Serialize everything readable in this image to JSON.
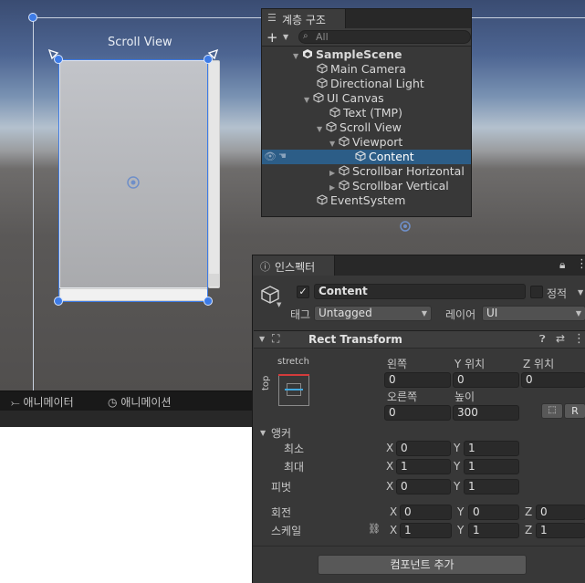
{
  "scene": {
    "canvas_label": "Scroll View"
  },
  "bottom_tabs": [
    {
      "label": "애니메이터",
      "icon": "animator-icon"
    },
    {
      "label": "애니메이션",
      "icon": "animation-icon"
    }
  ],
  "hierarchy": {
    "tab_label": "계층 구조",
    "tab_icon": "list-icon",
    "search_placeholder": "All",
    "add_icon": "plus-icon",
    "items": [
      {
        "label": "SampleScene",
        "depth": 0,
        "expanded": true,
        "icon": "unity-scene-icon",
        "bold": true
      },
      {
        "label": "Main Camera",
        "depth": 1,
        "icon": "cube-icon"
      },
      {
        "label": "Directional Light",
        "depth": 1,
        "icon": "cube-icon"
      },
      {
        "label": "UI Canvas",
        "depth": 1,
        "expanded": true,
        "icon": "cube-icon"
      },
      {
        "label": "Text (TMP)",
        "depth": 2,
        "icon": "cube-icon"
      },
      {
        "label": "Scroll View",
        "depth": 2,
        "expanded": true,
        "icon": "cube-icon"
      },
      {
        "label": "Viewport",
        "depth": 3,
        "expanded": true,
        "icon": "cube-icon"
      },
      {
        "label": "Content",
        "depth": 4,
        "selected": true,
        "icon": "cube-icon"
      },
      {
        "label": "Scrollbar Horizontal",
        "depth": 3,
        "collapsed": true,
        "icon": "cube-icon"
      },
      {
        "label": "Scrollbar Vertical",
        "depth": 3,
        "collapsed": true,
        "icon": "cube-icon"
      },
      {
        "label": "EventSystem",
        "depth": 1,
        "icon": "cube-icon"
      }
    ]
  },
  "inspector": {
    "tab_label": "인스펙터",
    "tab_icon": "info-icon",
    "object_name": "Content",
    "active_checked": true,
    "static_label": "정적",
    "tag_label": "태그",
    "tag_value": "Untagged",
    "layer_label": "레이어",
    "layer_value": "UI",
    "component_title": "Rect Transform",
    "anchor_preset_h": "stretch",
    "anchor_preset_v": "top",
    "pos": {
      "left_label": "왼쪽",
      "left_value": "0",
      "y_label": "Y 위치",
      "y_value": "0",
      "z_label": "Z 위치",
      "z_value": "0",
      "right_label": "오른쪽",
      "right_value": "0",
      "height_label": "높이",
      "height_value": "300"
    },
    "raw_button": "R",
    "anchors_label": "앵커",
    "min_label": "최소",
    "min_x": "0",
    "min_y": "1",
    "max_label": "최대",
    "max_x": "1",
    "max_y": "1",
    "pivot_label": "피벗",
    "pivot_x": "0",
    "pivot_y": "1",
    "rotation_label": "회전",
    "rot_x": "0",
    "rot_y": "0",
    "rot_z": "0",
    "scale_label": "스케일",
    "scale_x": "1",
    "scale_y": "1",
    "scale_z": "1",
    "axis_x": "X",
    "axis_y": "Y",
    "axis_z": "Z",
    "add_component": "컴포넌트 추가"
  },
  "colors": {
    "selection": "#2c5d87",
    "handle": "#3d7be6",
    "panel": "#383838"
  }
}
